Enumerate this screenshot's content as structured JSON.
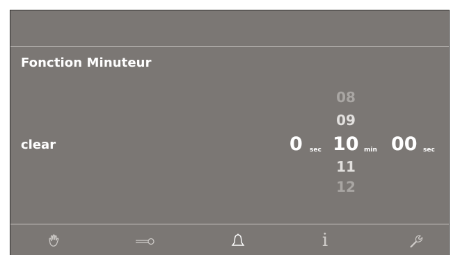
{
  "title": "Fonction Minuteur",
  "clear_label": "clear",
  "timer": {
    "seconds_value": "0",
    "seconds_unit": "sec",
    "minutes_value": "10",
    "minutes_unit": "min",
    "seconds2_value": "00",
    "seconds2_unit": "sec",
    "roller_above": [
      "08",
      "09"
    ],
    "roller_below": [
      "11",
      "12"
    ]
  },
  "bottom_icons": [
    "hand-icon",
    "key-icon",
    "bell-icon",
    "info-icon",
    "wrench-icon"
  ],
  "info_glyph": "i",
  "colors": {
    "background": "#7b7774",
    "text": "#ffffff",
    "faded_text": "#c8c6c4",
    "dim_text": "#a9a6a3",
    "divider": "#c9c6c3"
  }
}
